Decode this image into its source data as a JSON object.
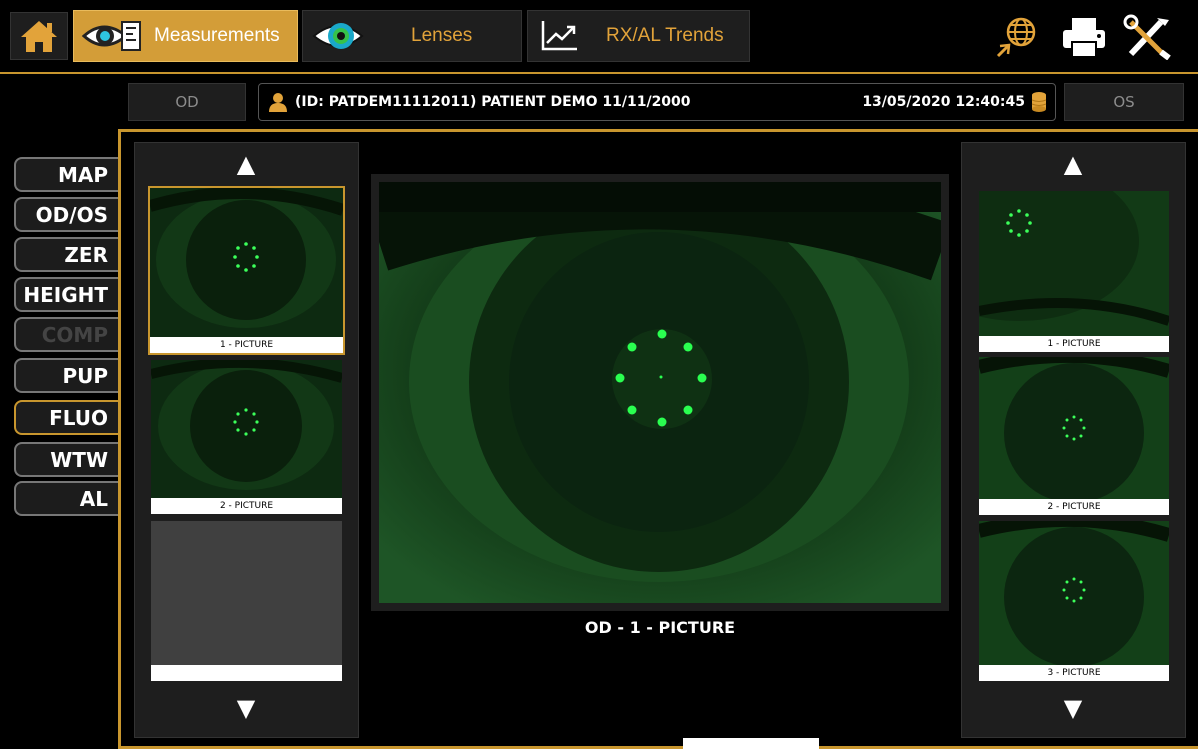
{
  "app": {
    "tabs": [
      {
        "label": "Measurements",
        "icon": "eye-ruler-icon",
        "active": true
      },
      {
        "label": "Lenses",
        "icon": "lens-eye-icon",
        "active": false
      },
      {
        "label": "RX/AL Trends",
        "icon": "trend-chart-icon",
        "active": false
      }
    ],
    "toolbar_icons": [
      "globe-icon",
      "printer-icon",
      "tools-icon"
    ],
    "accent_color": "#c8962e"
  },
  "patient_bar": {
    "od_label": "OD",
    "os_label": "OS",
    "patient_text": "(ID: PATDEM11112011) PATIENT DEMO 11/11/2000",
    "datetime": "13/05/2020 12:40:45"
  },
  "side_menu": [
    {
      "label": "MAP",
      "state": "normal"
    },
    {
      "label": "OD/OS",
      "state": "normal"
    },
    {
      "label": "ZER",
      "state": "normal"
    },
    {
      "label": "HEIGHT",
      "state": "normal"
    },
    {
      "label": "COMP",
      "state": "disabled"
    },
    {
      "label": "PUP",
      "state": "normal"
    },
    {
      "label": "FLUO",
      "state": "active"
    },
    {
      "label": "WTW",
      "state": "normal"
    },
    {
      "label": "AL",
      "state": "normal"
    }
  ],
  "left_panel": {
    "thumbnails": [
      {
        "caption": "1 - PICTURE",
        "selected": true
      },
      {
        "caption": "2 - PICTURE",
        "selected": false
      },
      {
        "caption": "",
        "selected": false,
        "empty": true
      }
    ]
  },
  "right_panel": {
    "thumbnails": [
      {
        "caption": "1 - PICTURE"
      },
      {
        "caption": "2 - PICTURE"
      },
      {
        "caption": "3 - PICTURE"
      }
    ]
  },
  "main_view": {
    "caption": "OD - 1 - PICTURE"
  }
}
